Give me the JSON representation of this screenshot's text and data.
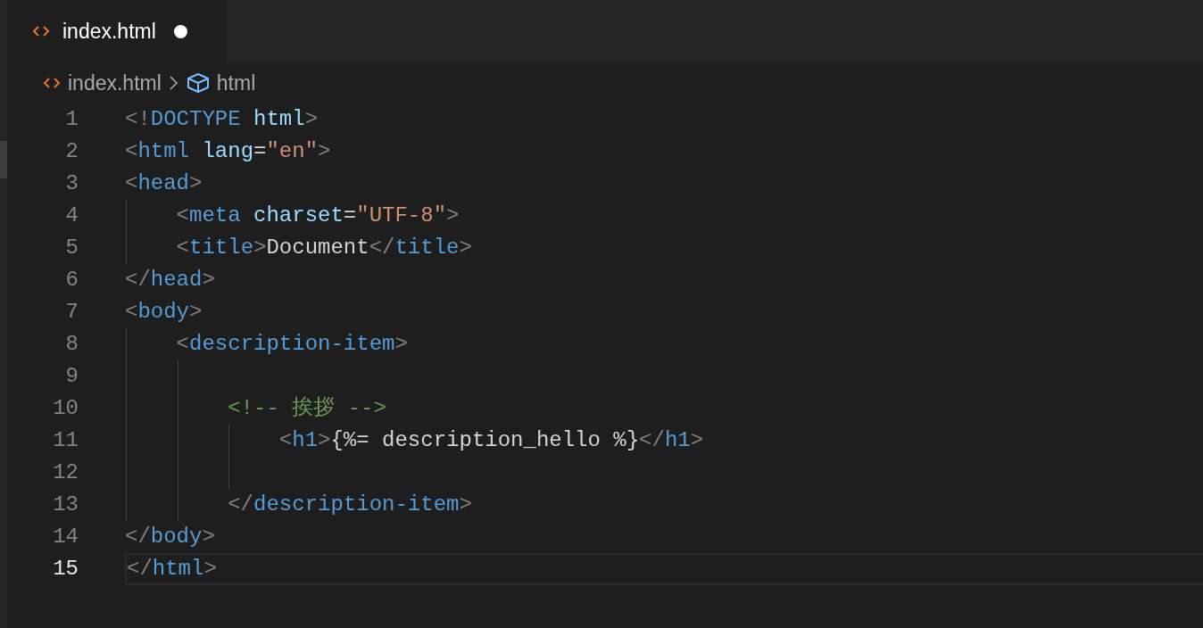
{
  "tabs": [
    {
      "label": "index.html",
      "selected": true,
      "modified": true
    }
  ],
  "breadcrumbs": [
    {
      "label": "index.html",
      "kind": "file"
    },
    {
      "label": "html",
      "kind": "symbol"
    }
  ],
  "lines": [
    {
      "number": "1",
      "current": false,
      "tokens": [
        {
          "text": "<!",
          "kind": "punct"
        },
        {
          "text": "DOCTYPE",
          "kind": "tag"
        },
        {
          "text": " html",
          "kind": "attr"
        },
        {
          "text": ">",
          "kind": "punct"
        }
      ]
    },
    {
      "number": "2",
      "current": false,
      "tokens": [
        {
          "text": "<",
          "kind": "punct"
        },
        {
          "text": "html",
          "kind": "tag"
        },
        {
          "text": " lang",
          "kind": "attr"
        },
        {
          "text": "=",
          "kind": "text"
        },
        {
          "text": "\"en\"",
          "kind": "string"
        },
        {
          "text": ">",
          "kind": "punct"
        }
      ]
    },
    {
      "number": "3",
      "current": false,
      "tokens": [
        {
          "text": "<",
          "kind": "punct"
        },
        {
          "text": "head",
          "kind": "tag"
        },
        {
          "text": ">",
          "kind": "punct"
        }
      ]
    },
    {
      "number": "4",
      "current": false,
      "tokens": [
        {
          "text": "    <",
          "kind": "punct"
        },
        {
          "text": "meta",
          "kind": "tag"
        },
        {
          "text": " charset",
          "kind": "attr"
        },
        {
          "text": "=",
          "kind": "text"
        },
        {
          "text": "\"UTF-8\"",
          "kind": "string"
        },
        {
          "text": ">",
          "kind": "punct"
        }
      ]
    },
    {
      "number": "5",
      "current": false,
      "tokens": [
        {
          "text": "    <",
          "kind": "punct"
        },
        {
          "text": "title",
          "kind": "tag"
        },
        {
          "text": ">",
          "kind": "punct"
        },
        {
          "text": "Document",
          "kind": "text"
        },
        {
          "text": "</",
          "kind": "punct"
        },
        {
          "text": "title",
          "kind": "tag"
        },
        {
          "text": ">",
          "kind": "punct"
        }
      ]
    },
    {
      "number": "6",
      "current": false,
      "tokens": [
        {
          "text": "</",
          "kind": "punct"
        },
        {
          "text": "head",
          "kind": "tag"
        },
        {
          "text": ">",
          "kind": "punct"
        }
      ]
    },
    {
      "number": "7",
      "current": false,
      "tokens": [
        {
          "text": "<",
          "kind": "punct"
        },
        {
          "text": "body",
          "kind": "tag"
        },
        {
          "text": ">",
          "kind": "punct"
        }
      ]
    },
    {
      "number": "8",
      "current": false,
      "tokens": [
        {
          "text": "    <",
          "kind": "punct"
        },
        {
          "text": "description-item",
          "kind": "tag"
        },
        {
          "text": ">",
          "kind": "punct"
        }
      ]
    },
    {
      "number": "9",
      "current": false
    },
    {
      "number": "10",
      "current": false,
      "tokens": [
        {
          "text": "        <!-- 挨拶 -->",
          "kind": "comment"
        }
      ]
    },
    {
      "number": "11",
      "current": false,
      "tokens": [
        {
          "text": "            <",
          "kind": "punct"
        },
        {
          "text": "h1",
          "kind": "tag"
        },
        {
          "text": ">",
          "kind": "punct"
        },
        {
          "text": "{%= description_hello %}",
          "kind": "text"
        },
        {
          "text": "</",
          "kind": "punct"
        },
        {
          "text": "h1",
          "kind": "tag"
        },
        {
          "text": ">",
          "kind": "punct"
        }
      ]
    },
    {
      "number": "12",
      "current": false
    },
    {
      "number": "13",
      "current": false,
      "tokens": [
        {
          "text": "        </",
          "kind": "punct"
        },
        {
          "text": "description-item",
          "kind": "tag"
        },
        {
          "text": ">",
          "kind": "punct"
        }
      ]
    },
    {
      "number": "14",
      "current": false,
      "tokens": [
        {
          "text": "</",
          "kind": "punct"
        },
        {
          "text": "body",
          "kind": "tag"
        },
        {
          "text": ">",
          "kind": "punct"
        }
      ]
    },
    {
      "number": "15",
      "current": true,
      "tokens": [
        {
          "text": "</",
          "kind": "punct"
        },
        {
          "text": "html",
          "kind": "tag"
        },
        {
          "text": ">",
          "kind": "punct"
        }
      ]
    }
  ]
}
